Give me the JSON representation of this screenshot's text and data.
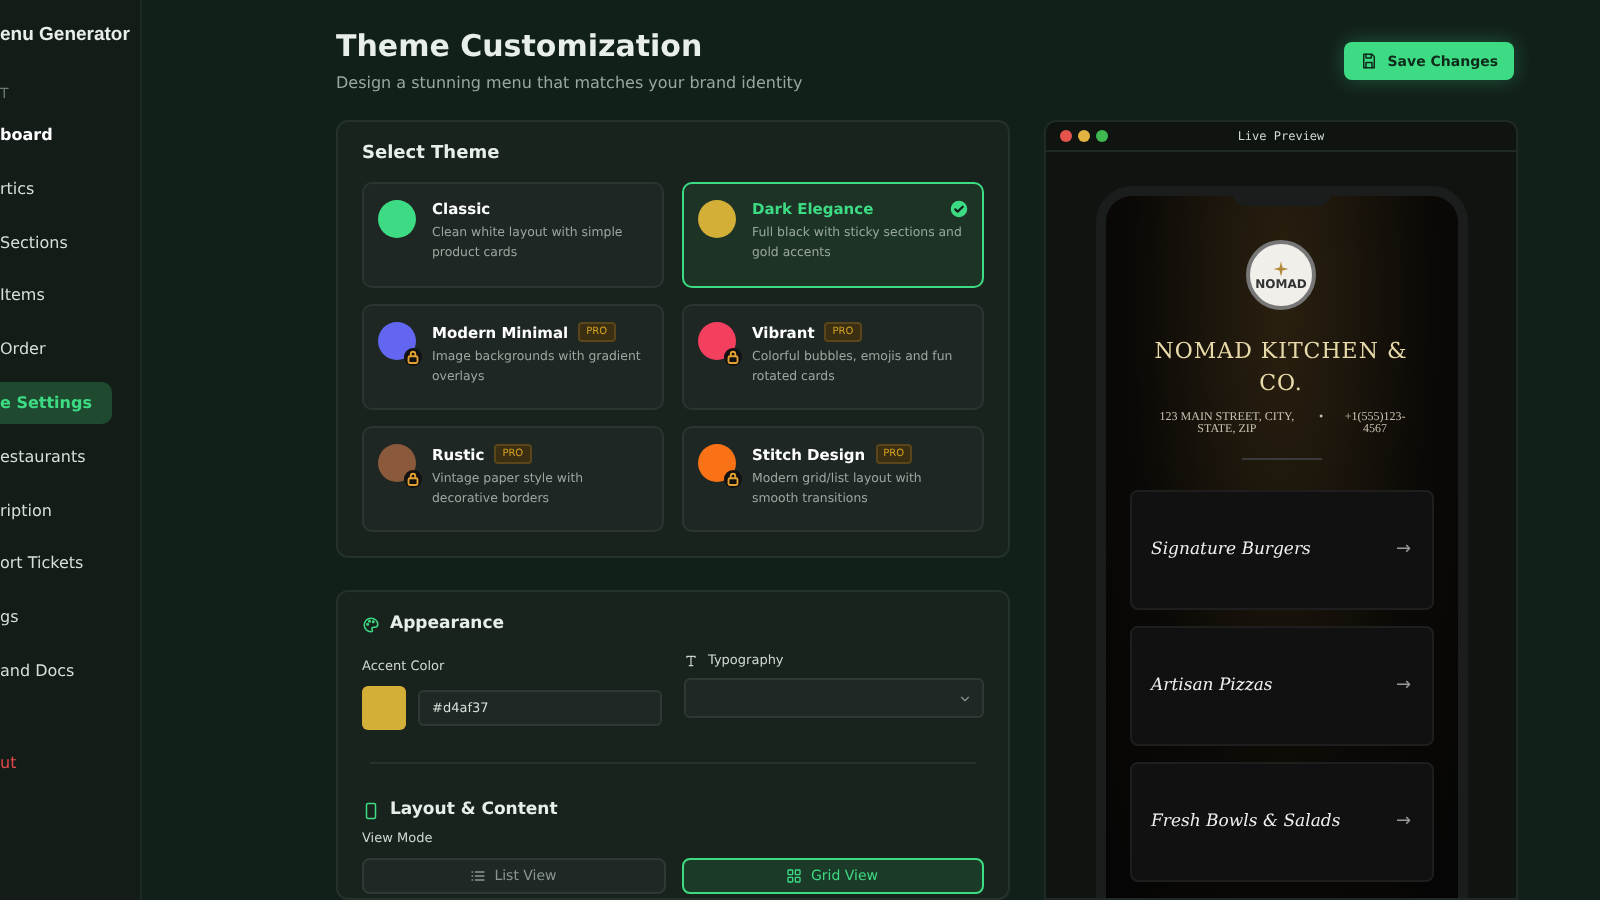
{
  "sidebar": {
    "brand": "enu Generator",
    "section_label": "T",
    "items": [
      {
        "label": "board",
        "selected": false,
        "kind": "nav"
      },
      {
        "label": "rtics",
        "selected": false,
        "kind": "nav"
      },
      {
        "label": "Sections",
        "selected": false,
        "kind": "nav"
      },
      {
        "label": "Items",
        "selected": false,
        "kind": "nav"
      },
      {
        "label": "Order",
        "selected": false,
        "kind": "nav"
      },
      {
        "label": "e Settings",
        "selected": true,
        "kind": "nav"
      },
      {
        "label": "estaurants",
        "selected": false,
        "kind": "nav"
      },
      {
        "label": "ription",
        "selected": false,
        "kind": "nav"
      },
      {
        "label": "ort Tickets",
        "selected": false,
        "kind": "nav"
      },
      {
        "label": "gs",
        "selected": false,
        "kind": "nav"
      },
      {
        "label": "and Docs",
        "selected": false,
        "kind": "nav"
      },
      {
        "label": "ut",
        "selected": false,
        "kind": "logout"
      }
    ]
  },
  "header": {
    "title": "Theme Customization",
    "subtitle": "Design a stunning menu that matches your brand identity",
    "save_button": "Save Changes"
  },
  "select_theme": {
    "title": "Select Theme",
    "themes": [
      {
        "name": "Classic",
        "description": "Clean white layout with simple product cards",
        "color": "#3ddc84",
        "locked": false,
        "selected": false
      },
      {
        "name": "Dark Elegance",
        "description": "Full black with sticky sections and gold accents",
        "color": "#d4af37",
        "locked": false,
        "selected": true
      },
      {
        "name": "Modern Minimal",
        "badge": "PRO",
        "description": "Image backgrounds with gradient overlays",
        "color": "#6366f1",
        "locked": true,
        "selected": false
      },
      {
        "name": "Vibrant",
        "badge": "PRO",
        "description": "Colorful bubbles, emojis and fun rotated cards",
        "color": "#f43f5e",
        "locked": true,
        "selected": false
      },
      {
        "name": "Rustic",
        "badge": "PRO",
        "description": "Vintage paper style with decorative borders",
        "color": "#8b5a3c",
        "locked": true,
        "selected": false
      },
      {
        "name": "Stitch Design",
        "badge": "PRO",
        "description": "Modern grid/list layout with smooth transitions",
        "color": "#f97316",
        "locked": true,
        "selected": false
      }
    ]
  },
  "appearance": {
    "title": "Appearance",
    "accent_label": "Accent Color",
    "accent_value": "#d4af37",
    "typography_label": "Typography"
  },
  "layout": {
    "title": "Layout & Content",
    "view_mode_label": "View Mode",
    "view_modes": [
      {
        "label": "List View",
        "kind": "list",
        "selected": false
      },
      {
        "label": "Grid View",
        "kind": "grid",
        "selected": true
      }
    ]
  },
  "preview": {
    "title": "Live Preview",
    "logo_text": "NOMAD",
    "restaurant_name": "NOMAD KITCHEN & CO.",
    "address": "123 MAIN STREET, CITY, STATE, ZIP",
    "separator": "•",
    "phone": "+1(555)123-4567",
    "categories": [
      {
        "name": "Signature Burgers",
        "arrow": "→"
      },
      {
        "name": "Artisan Pizzas",
        "arrow": "→"
      },
      {
        "name": "Fresh Bowls & Salads",
        "arrow": "→"
      }
    ]
  }
}
